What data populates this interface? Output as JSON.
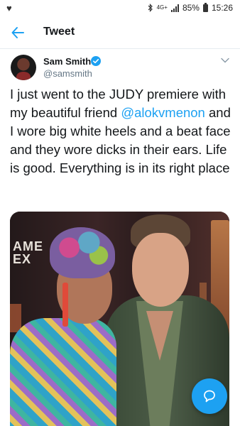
{
  "status_bar": {
    "network_type": "4G+",
    "battery_percent": "85%",
    "time": "15:26"
  },
  "header": {
    "title": "Tweet"
  },
  "author": {
    "name": "Sam Smith",
    "handle": "@samsmith",
    "verified": true
  },
  "tweet": {
    "text_before_mention": "I just went to the JUDY premiere with my beautiful friend ",
    "mention": "@alokvmenon",
    "text_after_mention": " and I wore big white heels and a beat face and they wore dicks in their ears. Life is good. Everything is in its right place"
  },
  "photo": {
    "sign_text_line1": "AME",
    "sign_text_line2": "EX"
  },
  "colors": {
    "accent": "#1da1f2",
    "secondary_text": "#657786",
    "primary_text": "#14171a"
  },
  "icons": {
    "back": "arrow-left-icon",
    "verified": "verified-badge-icon",
    "more": "chevron-down-icon",
    "reply_fab": "reply-bubble-icon"
  }
}
